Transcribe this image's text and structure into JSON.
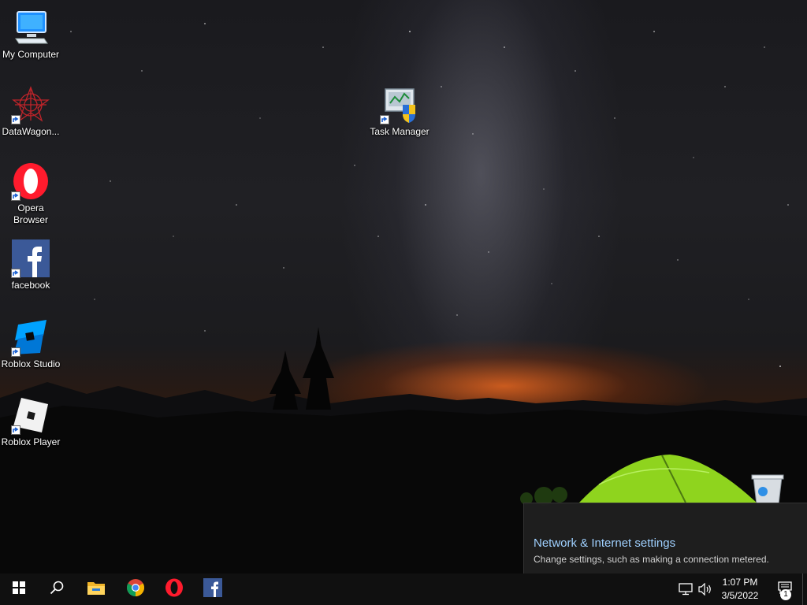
{
  "desktop": {
    "icons": [
      {
        "label": "My Computer",
        "icon": "computer-icon"
      },
      {
        "label": "DataWagon...",
        "icon": "datawagon-icon"
      },
      {
        "label": "Opera Browser",
        "icon": "opera-icon"
      },
      {
        "label": "facebook",
        "icon": "facebook-icon"
      },
      {
        "label": "Roblox Studio",
        "icon": "roblox-studio-icon"
      },
      {
        "label": "Roblox Player",
        "icon": "roblox-player-icon"
      },
      {
        "label": "Task Manager",
        "icon": "task-manager-icon"
      }
    ],
    "recycle_bin_icon": "recycle-bin-icon"
  },
  "notification": {
    "title": "Network & Internet settings",
    "subtitle": "Change settings, such as making a connection metered."
  },
  "taskbar": {
    "pinned": [
      "start-icon",
      "search-icon",
      "file-explorer-icon",
      "chrome-icon",
      "opera-icon",
      "facebook-icon"
    ],
    "clock": {
      "time": "1:07 PM",
      "date": "3/5/2022"
    },
    "notification_count": "1"
  },
  "colors": {
    "taskbar_bg": "#101010",
    "toast_title": "#9fd0ff",
    "facebook_blue": "#3b5998",
    "opera_red": "#ff1b2d",
    "tent_green": "#8fd41e"
  }
}
